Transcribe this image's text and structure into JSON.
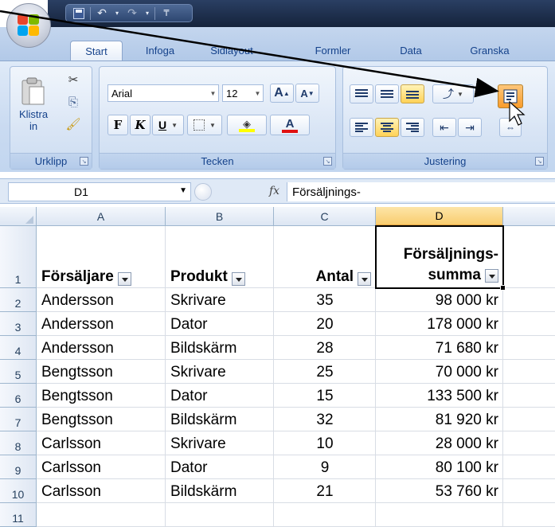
{
  "tabs": [
    {
      "label": "Start",
      "active": true
    },
    {
      "label": "Infoga",
      "active": false
    },
    {
      "label": "Sidlayout",
      "active": false
    },
    {
      "label": "Formler",
      "active": false
    },
    {
      "label": "Data",
      "active": false
    },
    {
      "label": "Granska",
      "active": false
    }
  ],
  "ribbon": {
    "clipboard": {
      "group_label": "Urklipp",
      "paste_label": "Klistra in",
      "icons": [
        "paste-icon",
        "cut-icon",
        "copy-icon",
        "format-painter-icon"
      ]
    },
    "font": {
      "group_label": "Tecken",
      "font_name": "Arial",
      "font_size": "12",
      "bold": "F",
      "italic": "K",
      "underline": "U",
      "grow_font": "A",
      "shrink_font": "A",
      "font_color_letter": "A",
      "fill_color": "#ffff00",
      "font_color": "#e01010"
    },
    "alignment": {
      "group_label": "Justering",
      "selected_button": "bottom-align"
    }
  },
  "formula_bar": {
    "name_box": "D1",
    "fx_label": "fx",
    "content": "Försäljnings-"
  },
  "grid": {
    "column_headers": [
      "A",
      "B",
      "C",
      "D"
    ],
    "selected_column": "D",
    "row_numbers": [
      "1",
      "2",
      "3",
      "4",
      "5",
      "6",
      "7",
      "8",
      "9",
      "10",
      "11"
    ],
    "header_row": {
      "seller": "Försäljare",
      "product": "Produkt",
      "quantity": "Antal",
      "sales_line1": "Försäljnings-",
      "sales_line2": "summa"
    },
    "rows": [
      {
        "seller": "Andersson",
        "product": "Skrivare",
        "quantity": "35",
        "sum": "98 000 kr"
      },
      {
        "seller": "Andersson",
        "product": "Dator",
        "quantity": "20",
        "sum": "178 000 kr"
      },
      {
        "seller": "Andersson",
        "product": "Bildskärm",
        "quantity": "28",
        "sum": "71 680 kr"
      },
      {
        "seller": "Bengtsson",
        "product": "Skrivare",
        "quantity": "25",
        "sum": "70 000 kr"
      },
      {
        "seller": "Bengtsson",
        "product": "Dator",
        "quantity": "15",
        "sum": "133 500 kr"
      },
      {
        "seller": "Bengtsson",
        "product": "Bildskärm",
        "quantity": "32",
        "sum": "81 920 kr"
      },
      {
        "seller": "Carlsson",
        "product": "Skrivare",
        "quantity": "10",
        "sum": "28 000 kr"
      },
      {
        "seller": "Carlsson",
        "product": "Dator",
        "quantity": "9",
        "sum": "80 100 kr"
      },
      {
        "seller": "Carlsson",
        "product": "Bildskärm",
        "quantity": "21",
        "sum": "53 760 kr"
      }
    ]
  },
  "colors": {
    "ribbon_accent": "#15428b",
    "selection_orange": "#f9cd6f",
    "titlebar": "#1f3150"
  }
}
